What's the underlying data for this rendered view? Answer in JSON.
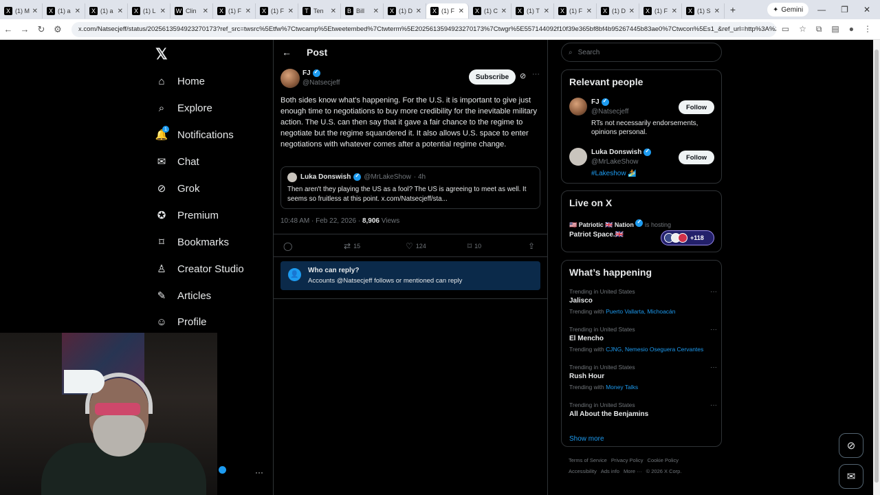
{
  "browser": {
    "tabs": [
      {
        "icon": "X",
        "title": "(1) M"
      },
      {
        "icon": "X",
        "title": "(1) a"
      },
      {
        "icon": "X",
        "title": "(1) a"
      },
      {
        "icon": "X",
        "title": "(1) L"
      },
      {
        "icon": "W",
        "title": "Clin"
      },
      {
        "icon": "X",
        "title": "(1) F"
      },
      {
        "icon": "X",
        "title": "(1) F"
      },
      {
        "icon": "T",
        "title": "Ten"
      },
      {
        "icon": "B",
        "title": "Bill"
      },
      {
        "icon": "X",
        "title": "(1) D"
      },
      {
        "icon": "X",
        "title": "(1) F"
      },
      {
        "icon": "X",
        "title": "(1) C"
      },
      {
        "icon": "X",
        "title": "(1) T"
      },
      {
        "icon": "X",
        "title": "(1) F"
      },
      {
        "icon": "X",
        "title": "(1) D"
      },
      {
        "icon": "X",
        "title": "(1) F"
      },
      {
        "icon": "X",
        "title": "(1) S"
      }
    ],
    "gemini_label": "Gemini",
    "url": "x.com/Natsecjeff/status/2025613594923270173?ref_src=twsrc%5Etfw%7Ctwcamp%5Etweetembed%7Ctwterm%5E2025613594923270173%7Ctwgr%5E557144092f10f39e365bf8bf4b95267445b83ae0%7Ctwcon%5Es1_&ref_url=http%3A%2F%"
  },
  "nav": {
    "items": [
      {
        "label": "Home",
        "icon": "home-icon"
      },
      {
        "label": "Explore",
        "icon": "search-icon"
      },
      {
        "label": "Notifications",
        "icon": "bell-icon",
        "badge": "1"
      },
      {
        "label": "Chat",
        "icon": "mail-icon"
      },
      {
        "label": "Grok",
        "icon": "grok-icon"
      },
      {
        "label": "Premium",
        "icon": "premium-icon"
      },
      {
        "label": "Bookmarks",
        "icon": "bookmark-icon"
      },
      {
        "label": "Creator Studio",
        "icon": "creator-icon"
      },
      {
        "label": "Articles",
        "icon": "articles-icon"
      },
      {
        "label": "Profile",
        "icon": "profile-icon"
      }
    ]
  },
  "main": {
    "header_title": "Post",
    "author": {
      "name": "FJ",
      "handle": "@Natsecjeff"
    },
    "subscribe_label": "Subscribe",
    "text": "Both sides know what's happening. For the U.S. it is important to give just enough time to negotiations to buy more credibility for the inevitable military action. The U.S. can then say that it gave a fair chance to the regime to negotiate but the regime squandered it. It also allows U.S. space to enter negotiations with whatever comes after a potential regime change.",
    "quote": {
      "name": "Luka Donswish",
      "handle": "@MrLakeShow",
      "time": "· 4h",
      "text": "Then aren't they playing the US as a fool? The US is agreeing to meet as well. It seems so fruitless at this point. x.com/Natsecjeff/sta..."
    },
    "meta": {
      "time": "10:48 AM · Feb 22, 2026 · ",
      "views": "8,906",
      "views_label": " Views"
    },
    "actions": {
      "reposts": "15",
      "likes": "124",
      "bookmarks": "10"
    },
    "who_can_reply": {
      "title": "Who can reply?",
      "subtitle": "Accounts @Natsecjeff follows or mentioned can reply"
    }
  },
  "right": {
    "search_placeholder": "Search",
    "relevant_title": "Relevant people",
    "people": [
      {
        "name": "FJ",
        "handle": "@Natsecjeff",
        "bio": "RTs not necessarily endorsements, opinions personal.",
        "follow": "Follow"
      },
      {
        "name": "Luka Donswish",
        "handle": "@MrLakeShow",
        "bio": "#Lakeshow 🏄",
        "follow": "Follow"
      }
    ],
    "live_title": "Live on X",
    "live": {
      "host": "🇺🇸 Patriotic 🇬🇧 Nation",
      "is_hosting": "is hosting",
      "space": "Patriot Space.🇬🇧",
      "count": "+118"
    },
    "happening_title": "What’s happening",
    "trends": [
      {
        "context": "Trending in United States",
        "name": "Jalisco",
        "with_label": "Trending with ",
        "with": "Puerto Vallarta, Michoacán"
      },
      {
        "context": "Trending in United States",
        "name": "El Mencho",
        "with_label": "Trending with ",
        "with": "CJNG, Nemesio Oseguera Cervantes"
      },
      {
        "context": "Trending in United States",
        "name": "Rush Hour",
        "with_label": "Trending with ",
        "with": "Money Talks"
      },
      {
        "context": "Trending in United States",
        "name": "All About the Benjamins",
        "with_label": "",
        "with": ""
      }
    ],
    "show_more": "Show more",
    "footer": [
      "Terms of Service",
      "Privacy Policy",
      "Cookie Policy",
      "Accessibility",
      "Ads info",
      "More ···",
      "© 2026 X Corp."
    ]
  },
  "colors": {
    "accent": "#1d9bf0",
    "background": "#000000",
    "border": "#2f3336",
    "muted": "#71767b"
  }
}
